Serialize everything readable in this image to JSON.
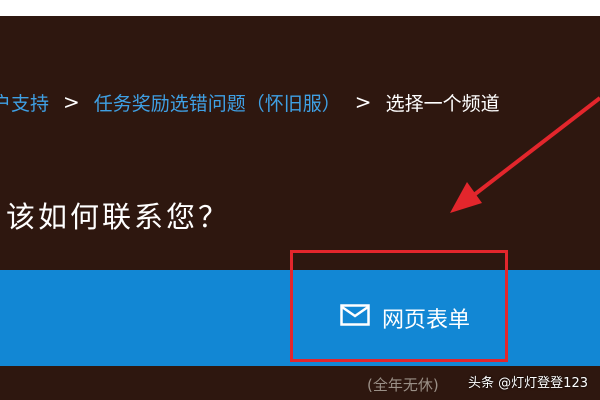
{
  "breadcrumb": {
    "items": [
      {
        "label": "户支持",
        "type": "link"
      },
      {
        "label": "任务奖励选错问题（怀旧服）",
        "type": "link"
      },
      {
        "label": "选择一个频道",
        "type": "current"
      }
    ],
    "separator": ">"
  },
  "heading": "该如何联系您？",
  "contact_options": {
    "web_form": {
      "label": "网页表单",
      "icon": "envelope-icon"
    },
    "note": "(全年无休)"
  },
  "annotation": {
    "highlight_color": "#e3262c"
  },
  "watermark": "头条 @灯灯登登123",
  "colors": {
    "background": "#2e170f",
    "link": "#3fa0e4",
    "contact_bar": "#1287d4",
    "annotation_red": "#e3262c"
  }
}
